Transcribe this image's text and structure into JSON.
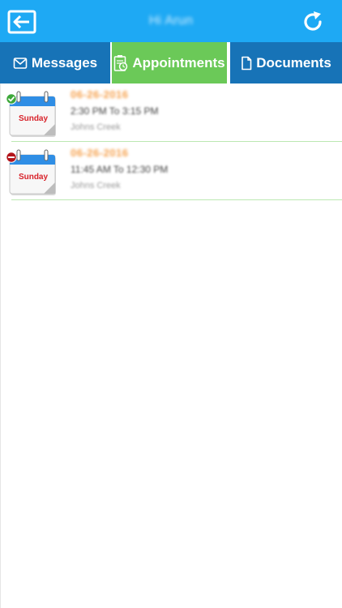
{
  "header": {
    "title": "Hi Arun",
    "back_icon": "exit-back-icon",
    "refresh_icon": "refresh-icon",
    "background": "#1ea9f4"
  },
  "tabs": [
    {
      "label": "Messages",
      "icon": "envelope-icon",
      "selected": false,
      "color": "#1773b7"
    },
    {
      "label": "Appointments",
      "icon": "clipboard-clock-icon",
      "selected": true,
      "color": "#6bc958"
    },
    {
      "label": "Documents",
      "icon": "document-icon",
      "selected": false,
      "color": "#1773b7"
    }
  ],
  "appointments": [
    {
      "date": "06-26-2016",
      "weekday": "Sunday",
      "time": "2:30 PM To 3:15 PM",
      "location": "Johns Creek",
      "status_icon": "check-circle-icon",
      "status_color": "#3ea83a"
    },
    {
      "date": "06-26-2016",
      "weekday": "Sunday",
      "time": "11:45 AM To 12:30 PM",
      "location": "Johns Creek",
      "status_icon": "minus-circle-icon",
      "status_color": "#b3151b"
    }
  ]
}
